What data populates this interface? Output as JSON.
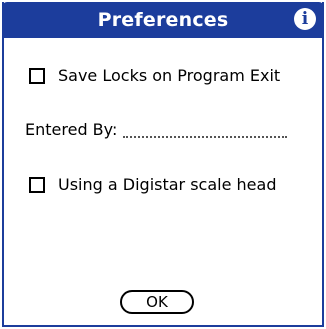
{
  "dialog": {
    "title": "Preferences",
    "info_icon": "info-icon",
    "accent_color": "#1c3d9c"
  },
  "options": {
    "save_locks": {
      "label": "Save Locks on Program Exit",
      "checked": false
    },
    "entered_by": {
      "label": "Entered By:",
      "value": ""
    },
    "digistar": {
      "label": "Using a Digistar scale head",
      "checked": false
    }
  },
  "buttons": {
    "ok_label": "OK"
  }
}
